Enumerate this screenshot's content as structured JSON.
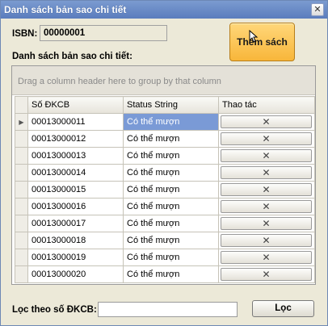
{
  "window": {
    "title": "Danh sách bản sao chi tiết",
    "close_label": "✕"
  },
  "isbn": {
    "label": "ISBN:",
    "value": "00000001"
  },
  "add_button_label": "Thêm sách",
  "list_label": "Danh sách bản sao chi tiết:",
  "grid": {
    "group_hint": "Drag a column header here to group by that column",
    "columns": [
      "Số ĐKCB",
      "Status String",
      "Thao tác"
    ],
    "selected_row": 0,
    "rows": [
      {
        "code": "00013000011",
        "status": "Có thể mượn",
        "action": "✕"
      },
      {
        "code": "00013000012",
        "status": "Có thể mượn",
        "action": "✕"
      },
      {
        "code": "00013000013",
        "status": "Có thể mượn",
        "action": "✕"
      },
      {
        "code": "00013000014",
        "status": "Có thể mượn",
        "action": "✕"
      },
      {
        "code": "00013000015",
        "status": "Có thể mượn",
        "action": "✕"
      },
      {
        "code": "00013000016",
        "status": "Có thể mượn",
        "action": "✕"
      },
      {
        "code": "00013000017",
        "status": "Có thể mượn",
        "action": "✕"
      },
      {
        "code": "00013000018",
        "status": "Có thể mượn",
        "action": "✕"
      },
      {
        "code": "00013000019",
        "status": "Có thể mượn",
        "action": "✕"
      },
      {
        "code": "00013000020",
        "status": "Có thể mượn",
        "action": "✕"
      }
    ]
  },
  "filter": {
    "label": "Lọc theo số ĐKCB:",
    "value": "",
    "button_label": "Lọc"
  },
  "colors": {
    "accent_button": "#f8b63a",
    "selection": "#7a9ad6",
    "titlebar": "#5a7cbd"
  }
}
